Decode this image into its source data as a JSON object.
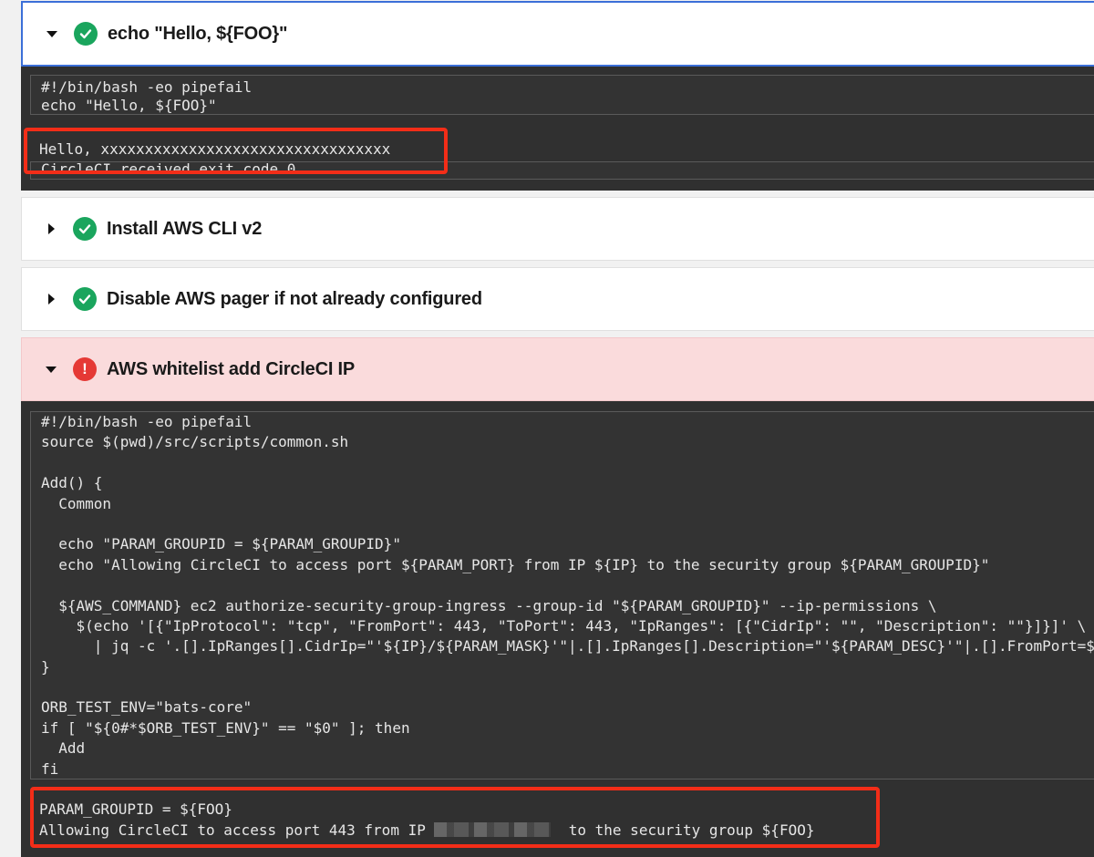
{
  "steps": [
    {
      "title": "echo \"Hello, ${FOO}\"",
      "status": "success",
      "expanded": true
    },
    {
      "title": "Install AWS CLI v2",
      "status": "success",
      "expanded": false
    },
    {
      "title": "Disable AWS pager if not already configured",
      "status": "success",
      "expanded": false
    },
    {
      "title": "AWS whitelist add CircleCI IP",
      "status": "failed",
      "expanded": true
    }
  ],
  "step1": {
    "command": [
      "#!/bin/bash -eo pipefail",
      "echo \"Hello, ${FOO}\""
    ],
    "output": [
      "Hello, xxxxxxxxxxxxxxxxxxxxxxxxxxxxxxxxx",
      "CircleCI received exit code 0"
    ]
  },
  "step4": {
    "command": [
      "#!/bin/bash -eo pipefail",
      "source $(pwd)/src/scripts/common.sh",
      "",
      "Add() {",
      "  Common",
      "",
      "  echo \"PARAM_GROUPID = ${PARAM_GROUPID}\"",
      "  echo \"Allowing CircleCI to access port ${PARAM_PORT} from IP ${IP} to the security group ${PARAM_GROUPID}\"",
      "",
      "  ${AWS_COMMAND} ec2 authorize-security-group-ingress --group-id \"${PARAM_GROUPID}\" --ip-permissions \\",
      "    $(echo '[{\"IpProtocol\": \"tcp\", \"FromPort\": 443, \"ToPort\": 443, \"IpRanges\": [{\"CidrIp\": \"\", \"Description\": \"\"}]}]' \\",
      "      | jq -c '.[].IpRanges[].CidrIp=\"'${IP}/${PARAM_MASK}'\"|.[].IpRanges[].Description=\"'${PARAM_DESC}'\"|.[].FromPort=${PARAM_PORT}')",
      "}",
      "",
      "ORB_TEST_ENV=\"bats-core\"",
      "if [ \"${0#*$ORB_TEST_ENV}\" == \"$0\" ]; then",
      "  Add",
      "fi"
    ],
    "output_line1": "PARAM_GROUPID = ${FOO}",
    "output_line2_prefix": "Allowing CircleCI to access port 443 from IP",
    "output_line2_suffix": "to the security group ${FOO}"
  },
  "colors": {
    "success": "#1aa55d",
    "failed": "#e53935",
    "highlight": "#f32d18",
    "active_border": "#3b6fd8"
  },
  "icons": {
    "success": "check-circle-icon",
    "failed": "exclamation-circle-icon",
    "expanded": "caret-down-icon",
    "collapsed": "caret-right-icon"
  }
}
